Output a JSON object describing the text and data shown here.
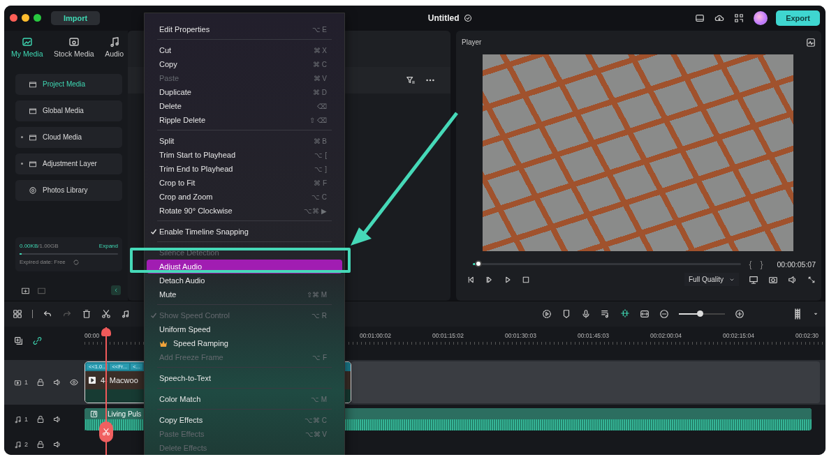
{
  "window": {
    "title": "Untitled"
  },
  "toolbar": {
    "import_button": "Import",
    "export_button": "Export"
  },
  "media_tabs": [
    {
      "label": "My Media",
      "selected": true,
      "kind": "media"
    },
    {
      "label": "Stock Media",
      "selected": false,
      "kind": "stock"
    },
    {
      "label": "Audio",
      "selected": false,
      "kind": "audio"
    }
  ],
  "sidebar": {
    "items": [
      {
        "label": "Project Media",
        "selected": true,
        "expandable": false,
        "kind": "folder"
      },
      {
        "label": "Global Media",
        "selected": false,
        "expandable": false,
        "kind": "folder"
      },
      {
        "label": "Cloud Media",
        "selected": false,
        "expandable": true,
        "kind": "folder"
      },
      {
        "label": "Adjustment Layer",
        "selected": false,
        "expandable": true,
        "kind": "folder"
      },
      {
        "label": "Photos Library",
        "selected": false,
        "expandable": false,
        "kind": "photos"
      }
    ],
    "storage": {
      "used": "0.00KB",
      "total": "/1.00GB",
      "level": 0.02,
      "expand": "Expand",
      "expiry": "Expired date: Free"
    }
  },
  "player": {
    "title": "Player",
    "level": 0.02,
    "in_mark": "{",
    "out_mark": "}",
    "timecode": "00:00:05:07",
    "quality": "Full Quality"
  },
  "context_menu": {
    "items": [
      {
        "kind": "item",
        "label": "Edit Properties",
        "shortcut": "⌥ E",
        "disabled": false,
        "checked": false,
        "selected": false,
        "premium": false
      },
      {
        "kind": "separator"
      },
      {
        "kind": "item",
        "label": "Cut",
        "shortcut": "⌘ X",
        "disabled": false,
        "checked": false,
        "selected": false,
        "premium": false
      },
      {
        "kind": "item",
        "label": "Copy",
        "shortcut": "⌘ C",
        "disabled": false,
        "checked": false,
        "selected": false,
        "premium": false
      },
      {
        "kind": "item",
        "label": "Paste",
        "shortcut": "⌘ V",
        "disabled": true,
        "checked": false,
        "selected": false,
        "premium": false
      },
      {
        "kind": "item",
        "label": "Duplicate",
        "shortcut": "⌘ D",
        "disabled": false,
        "checked": false,
        "selected": false,
        "premium": false
      },
      {
        "kind": "item",
        "label": "Delete",
        "shortcut": "⌫",
        "disabled": false,
        "checked": false,
        "selected": false,
        "premium": false
      },
      {
        "kind": "item",
        "label": "Ripple Delete",
        "shortcut": "⇧ ⌫",
        "disabled": false,
        "checked": false,
        "selected": false,
        "premium": false
      },
      {
        "kind": "separator"
      },
      {
        "kind": "item",
        "label": "Split",
        "shortcut": "⌘ B",
        "disabled": false,
        "checked": false,
        "selected": false,
        "premium": false
      },
      {
        "kind": "item",
        "label": "Trim Start to Playhead",
        "shortcut": "⌥ [",
        "disabled": false,
        "checked": false,
        "selected": false,
        "premium": false
      },
      {
        "kind": "item",
        "label": "Trim End to Playhead",
        "shortcut": "⌥ ]",
        "disabled": false,
        "checked": false,
        "selected": false,
        "premium": false
      },
      {
        "kind": "item",
        "label": "Crop to Fit",
        "shortcut": "⌘ F",
        "disabled": false,
        "checked": false,
        "selected": false,
        "premium": false
      },
      {
        "kind": "item",
        "label": "Crop and Zoom",
        "shortcut": "⌥ C",
        "disabled": false,
        "checked": false,
        "selected": false,
        "premium": false
      },
      {
        "kind": "item",
        "label": "Rotate 90° Clockwise",
        "shortcut": "⌥⌘ ▶",
        "disabled": false,
        "checked": false,
        "selected": false,
        "premium": false
      },
      {
        "kind": "separator"
      },
      {
        "kind": "item",
        "label": "Enable Timeline Snapping",
        "disabled": false,
        "checked": true,
        "selected": false,
        "premium": false
      },
      {
        "kind": "separator"
      },
      {
        "kind": "item",
        "label": "Silence Detection",
        "disabled": true,
        "checked": false,
        "selected": false,
        "premium": false
      },
      {
        "kind": "item",
        "label": "Adjust Audio",
        "disabled": false,
        "checked": false,
        "selected": true,
        "premium": false
      },
      {
        "kind": "item",
        "label": "Detach Audio",
        "disabled": false,
        "checked": false,
        "selected": false,
        "premium": false
      },
      {
        "kind": "item",
        "label": "Mute",
        "shortcut": "⇧⌘ M",
        "disabled": false,
        "checked": false,
        "selected": false,
        "premium": false
      },
      {
        "kind": "separator"
      },
      {
        "kind": "item",
        "label": "Show Speed Control",
        "shortcut": "⌥ R",
        "disabled": true,
        "checked": true,
        "selected": false,
        "premium": false
      },
      {
        "kind": "item",
        "label": "Uniform Speed",
        "disabled": false,
        "checked": false,
        "selected": false,
        "premium": false
      },
      {
        "kind": "item",
        "label": "Speed Ramping",
        "disabled": false,
        "checked": false,
        "selected": false,
        "premium": true
      },
      {
        "kind": "item",
        "label": "Add Freeze Frame",
        "shortcut": "⌥ F",
        "disabled": true,
        "checked": false,
        "selected": false,
        "premium": false
      },
      {
        "kind": "separator"
      },
      {
        "kind": "item",
        "label": "Speech-to-Text",
        "disabled": false,
        "checked": false,
        "selected": false,
        "premium": false
      },
      {
        "kind": "separator"
      },
      {
        "kind": "item",
        "label": "Color Match",
        "shortcut": "⌥ M",
        "disabled": false,
        "checked": false,
        "selected": false,
        "premium": false
      },
      {
        "kind": "separator"
      },
      {
        "kind": "item",
        "label": "Copy Effects",
        "shortcut": "⌥⌘ C",
        "disabled": false,
        "checked": false,
        "selected": false,
        "premium": false
      },
      {
        "kind": "item",
        "label": "Paste Effects",
        "shortcut": "⌥⌘ V",
        "disabled": true,
        "checked": false,
        "selected": false,
        "premium": false
      },
      {
        "kind": "item",
        "label": "Delete Effects",
        "disabled": true,
        "checked": false,
        "selected": false,
        "premium": false
      }
    ]
  },
  "timeline": {
    "zoom": {
      "level": 0.45
    },
    "ruler": [
      "00:00",
      "00:01:00:02",
      "00:01:15:02",
      "00:01:30:03",
      "00:01:45:03",
      "00:02:00:04",
      "00:02:15:04",
      "00:02:30"
    ],
    "tracks": [
      {
        "kind": "video",
        "number": "1",
        "clip": {
          "tags": [
            "<<1.0...",
            "<<Fr...",
            "<..."
          ],
          "title": "4- Macwoo"
        }
      },
      {
        "kind": "audio",
        "number": "1",
        "clip": {
          "title": "Living Puls"
        }
      },
      {
        "kind": "audio",
        "number": "2"
      }
    ]
  }
}
